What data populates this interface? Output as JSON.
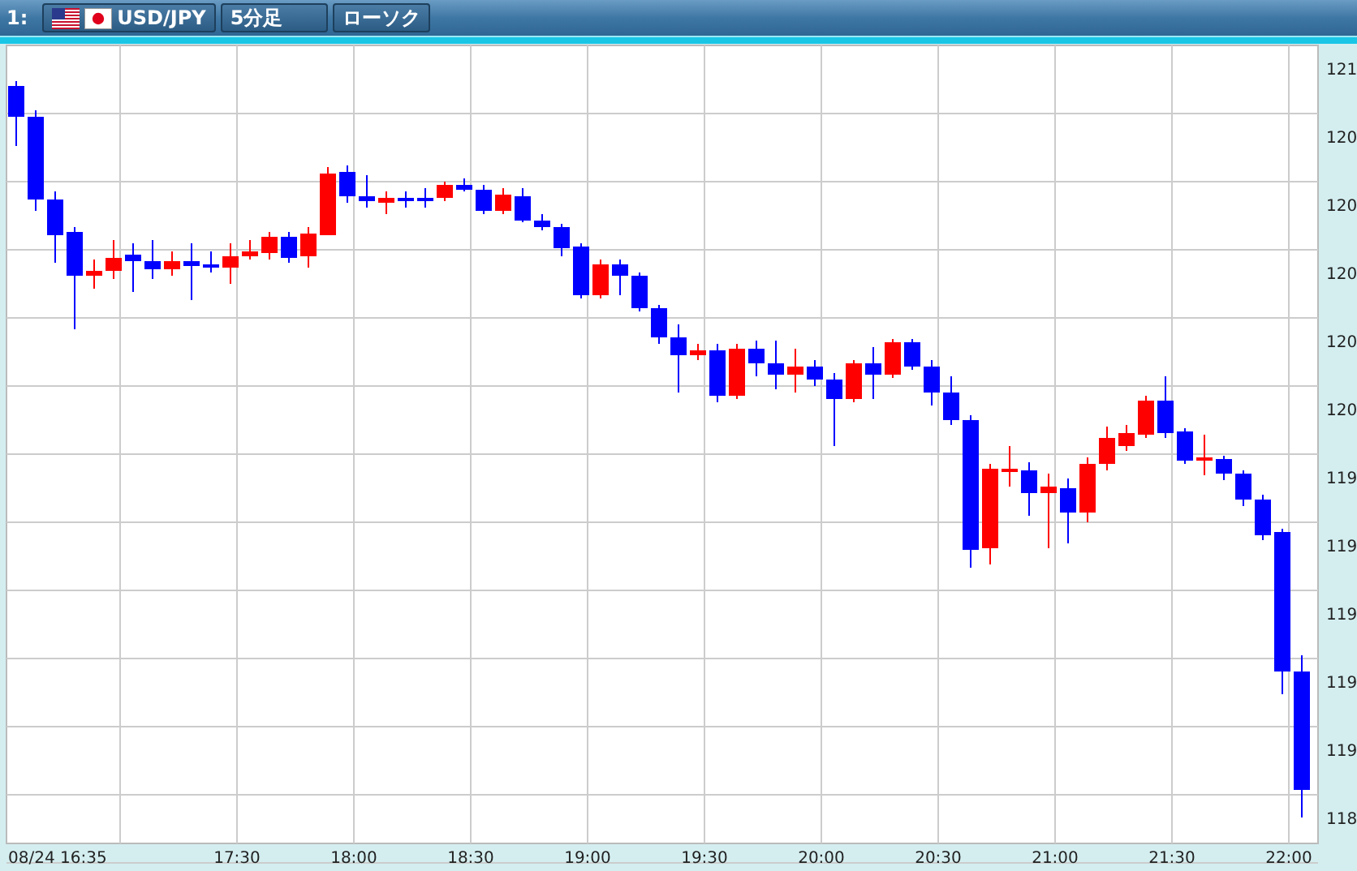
{
  "toolbar": {
    "index": "1:",
    "pair": "USD/JPY",
    "timeframe": "5分足",
    "chart_type": "ローソク"
  },
  "chart": {
    "y_labels": [
      "121",
      "120",
      "120",
      "120",
      "120",
      "120",
      "119",
      "119",
      "119",
      "119",
      "119",
      "118"
    ],
    "x_labels": [
      "08/24 16:35",
      "17:30",
      "18:00",
      "18:30",
      "19:00",
      "19:30",
      "20:00",
      "20:30",
      "21:00",
      "21:30",
      "22:00"
    ]
  }
}
